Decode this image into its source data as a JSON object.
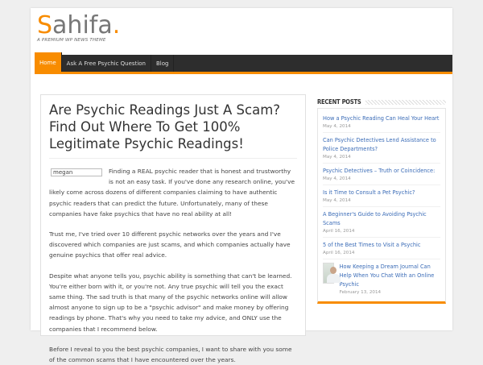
{
  "logo": {
    "name_first": "S",
    "name_rest": "ahifa",
    "dot": ".",
    "tagline": "A PREMIUM WP NEWS THEME"
  },
  "nav": [
    "Home",
    "Ask A Free Psychic Question",
    "Blog"
  ],
  "article": {
    "title": "Are Psychic Readings Just A Scam? Find Out Where To Get 100% Legitimate Psychic Readings!",
    "image_alt": "megan",
    "paragraphs": [
      "Finding a REAL psychic reader that is honest and trustworthy is not an easy task.  If you've done any research online, you've likely come across dozens of different companies claiming to have authentic psychic readers that can predict the future.  Unfortunately, many of these companies have fake psychics that have no real ability at all!",
      "Trust me, I've tried over 10 different psychic networks over the years and I've discovered which companies are just scams, and which companies actually have genuine psychics that offer real advice.",
      "Despite what anyone tells you, psychic ability is something that can't be learned.  You're either born with it, or you're not.  Any true psychic will tell you the exact same thing.  The sad truth is that many of the psychic networks online will allow almost anyone to sign up to be a \"psychic advisor\" and make money by offering readings by phone.  That's why you need to take my advice, and ONLY use the companies that I recommend below.",
      "Before I reveal to you the best psychic companies, I want to share with you some of the common scams that I have encountered over the years."
    ]
  },
  "sidebar": {
    "title": "RECENT POSTS",
    "posts": [
      {
        "title": "How a Psychic Reading Can Heal Your Heart",
        "date": "May 4, 2014"
      },
      {
        "title": "Can Psychic Detectives Lend Assistance to Police Departments?",
        "date": "May 4, 2014"
      },
      {
        "title": "Psychic Detectives – Truth or Coincidence:",
        "date": "May 4, 2014"
      },
      {
        "title": "Is it Time to Consult a Pet Psychic?",
        "date": "May 4, 2014"
      },
      {
        "title": "A Beginner's Guide to Avoiding Psychic Scams",
        "date": "April 16, 2014"
      },
      {
        "title": "5 of the Best Times to Visit a Psychic",
        "date": "April 16, 2014"
      },
      {
        "title": "How Keeping a Dream Journal Can Help When You Chat With an Online Psychic",
        "date": "February 13, 2014"
      }
    ]
  },
  "colors": {
    "accent": "#f88c00",
    "nav": "#2d2d2d",
    "link": "#3b6cb7"
  }
}
